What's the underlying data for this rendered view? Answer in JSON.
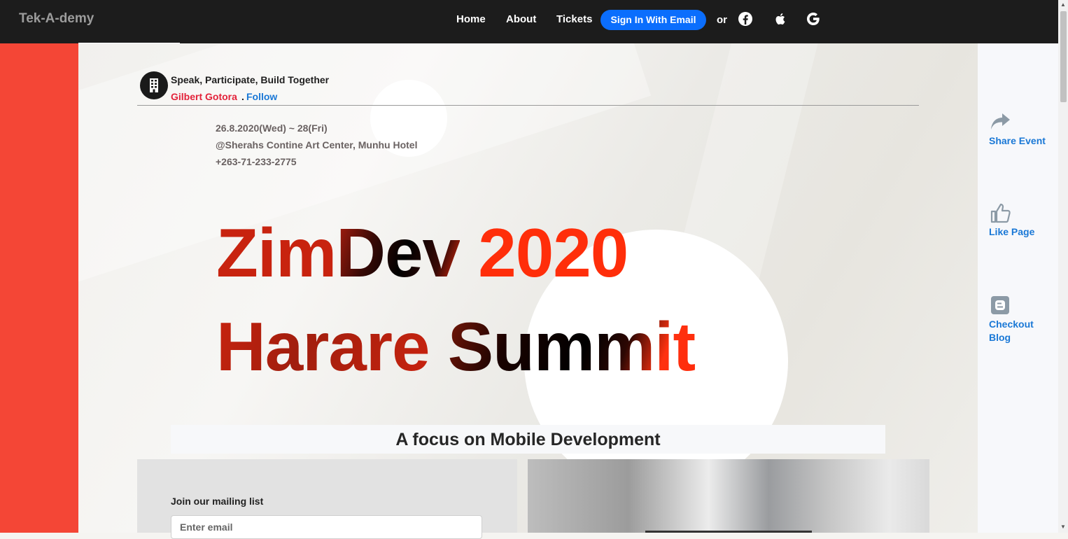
{
  "nav": {
    "brand": "Tek-A-demy",
    "links": [
      "Home",
      "About",
      "Tickets"
    ],
    "signin_label": "Sign In With Email",
    "or_label": "or",
    "social_icons": [
      "facebook-icon",
      "apple-icon",
      "google-icon"
    ]
  },
  "organizer": {
    "title": "Speak, Participate, Build Together",
    "author": "Gilbert Gotora",
    "separator": ".",
    "follow_label": "Follow"
  },
  "event": {
    "date": "26.8.2020(Wed) ~ 28(Fri)",
    "venue": "@Sherahs Contine Art Center, Munhu Hotel",
    "phone": "+263-71-233-2775"
  },
  "headline": {
    "line1_a": "Zim",
    "line1_b": "Dev",
    "line1_c": "2020",
    "line2_a": "Harare",
    "line2_b": "Summit"
  },
  "tagline": "A focus on Mobile Development",
  "mailing": {
    "label": "Join our mailing list",
    "placeholder": "Enter email"
  },
  "rail": {
    "share_label": "Share Event",
    "like_label": "Like Page",
    "blog_label": "Checkout Blog"
  },
  "colors": {
    "accent_red": "#f44636",
    "link_blue": "#1a78d6",
    "signin_blue": "#0b6efd",
    "navbar_bg": "#1c1c1c"
  }
}
